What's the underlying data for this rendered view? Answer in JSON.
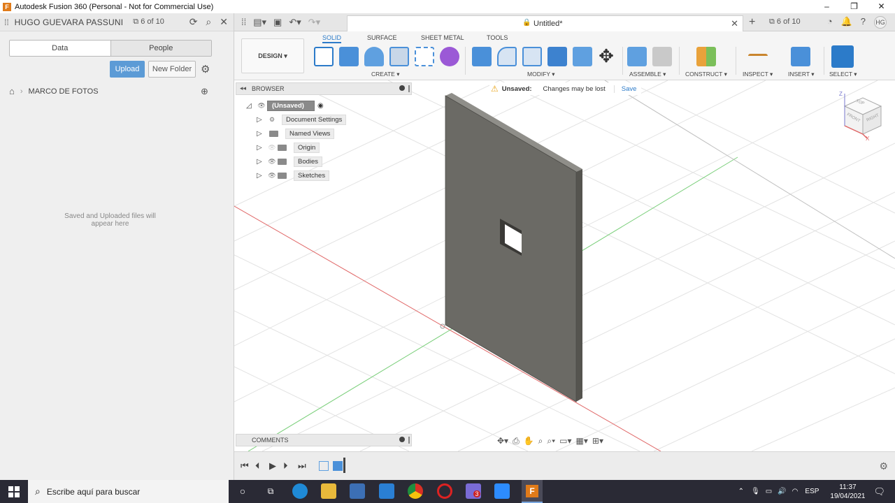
{
  "window": {
    "title": "Autodesk Fusion 360 (Personal - Not for Commercial Use)",
    "app_icon_letter": "F",
    "controls": [
      "–",
      "❐",
      "✕"
    ]
  },
  "data_panel": {
    "user": "HUGO GUEVARA PASSUNI",
    "jobs_count": "6 of 10",
    "tabs": [
      "Data",
      "People"
    ],
    "upload_label": "Upload",
    "new_folder_label": "New Folder",
    "breadcrumb": "MARCO DE FOTOS",
    "empty_message": "Saved and Uploaded files will appear here"
  },
  "app_header": {
    "document_name": "Untitled*",
    "jobs_count": "6 of 10",
    "avatar_initials": "HG"
  },
  "ribbon": {
    "tabs": [
      "SOLID",
      "SURFACE",
      "SHEET METAL",
      "TOOLS"
    ],
    "active_tab": "SOLID",
    "workspace": "DESIGN ▾",
    "groups": [
      "CREATE ▾",
      "MODIFY ▾",
      "ASSEMBLE ▾",
      "CONSTRUCT ▾",
      "INSPECT ▾",
      "INSERT ▾",
      "SELECT ▾"
    ]
  },
  "browser": {
    "title": "BROWSER",
    "root": "(Unsaved)",
    "items": [
      "Document Settings",
      "Named Views",
      "Origin",
      "Bodies",
      "Sketches"
    ]
  },
  "unsaved_bar": {
    "label": "Unsaved:",
    "message": "Changes may be lost",
    "save_label": "Save"
  },
  "viewcube": {
    "faces": [
      "TOP",
      "FRONT",
      "RIGHT"
    ],
    "axes": [
      "Z",
      "X"
    ]
  },
  "comments": {
    "title": "COMMENTS"
  },
  "taskbar": {
    "search_placeholder": "Escribe aquí para buscar",
    "language": "ESP",
    "time": "11:37",
    "date": "19/04/2021",
    "badge": "3"
  },
  "colors": {
    "accent_blue": "#2c7bc9",
    "upload_blue": "#5c9bd6",
    "body_gray": "#6b6a65",
    "axis_red": "#e06666",
    "axis_green": "#7bcf7b"
  }
}
